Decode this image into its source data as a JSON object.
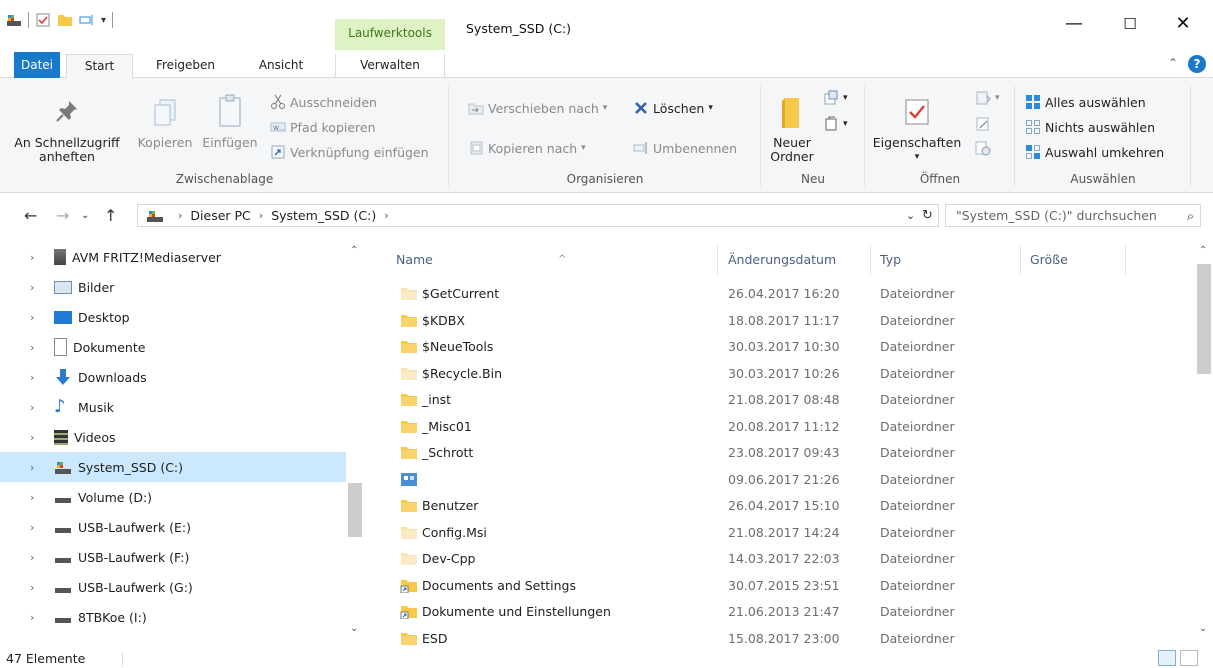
{
  "titlebar": {
    "context_tab": "Laufwerktools",
    "title": "System_SSD (C:)",
    "minimize": "—",
    "maximize": "☐",
    "close": "✕"
  },
  "tabs": {
    "file": "Datei",
    "start": "Start",
    "share": "Freigeben",
    "view": "Ansicht",
    "manage": "Verwalten"
  },
  "ribbon": {
    "clipboard": {
      "label": "Zwischenablage",
      "pin_line1": "An Schnellzugriff",
      "pin_line2": "anheften",
      "copy": "Kopieren",
      "paste": "Einfügen",
      "cut": "Ausschneiden",
      "copy_path": "Pfad kopieren",
      "paste_shortcut": "Verknüpfung einfügen"
    },
    "organize": {
      "label": "Organisieren",
      "move_to": "Verschieben nach",
      "copy_to": "Kopieren nach",
      "delete": "Löschen",
      "rename": "Umbenennen"
    },
    "new": {
      "label": "Neu",
      "new_folder_line1": "Neuer",
      "new_folder_line2": "Ordner"
    },
    "open": {
      "label": "Öffnen",
      "properties": "Eigenschaften"
    },
    "select": {
      "label": "Auswählen",
      "select_all": "Alles auswählen",
      "select_none": "Nichts auswählen",
      "invert": "Auswahl umkehren"
    }
  },
  "address": {
    "crumbs": [
      "Dieser PC",
      "System_SSD (C:)"
    ],
    "search_placeholder": "\"System_SSD (C:)\" durchsuchen"
  },
  "nav": {
    "items": [
      {
        "label": "AVM FRITZ!Mediaserver",
        "icon": "media-server-icon"
      },
      {
        "label": "Bilder",
        "icon": "pictures-icon"
      },
      {
        "label": "Desktop",
        "icon": "desktop-icon"
      },
      {
        "label": "Dokumente",
        "icon": "documents-icon"
      },
      {
        "label": "Downloads",
        "icon": "downloads-icon"
      },
      {
        "label": "Musik",
        "icon": "music-icon"
      },
      {
        "label": "Videos",
        "icon": "videos-icon"
      },
      {
        "label": "System_SSD (C:)",
        "icon": "system-drive-icon"
      },
      {
        "label": "Volume (D:)",
        "icon": "drive-icon"
      },
      {
        "label": "USB-Laufwerk (E:)",
        "icon": "drive-icon"
      },
      {
        "label": "USB-Laufwerk (F:)",
        "icon": "drive-icon"
      },
      {
        "label": "USB-Laufwerk (G:)",
        "icon": "drive-icon"
      },
      {
        "label": "8TBKoe (I:)",
        "icon": "drive-icon"
      }
    ],
    "selected_index": 7
  },
  "list": {
    "columns": {
      "name": "Name",
      "date": "Änderungsdatum",
      "type": "Typ",
      "size": "Größe"
    },
    "rows": [
      {
        "name": "$GetCurrent",
        "date": "26.04.2017 16:20",
        "type": "Dateiordner",
        "icon": "folder-light-icon"
      },
      {
        "name": "$KDBX",
        "date": "18.08.2017 11:17",
        "type": "Dateiordner",
        "icon": "folder-icon"
      },
      {
        "name": "$NeueTools",
        "date": "30.03.2017 10:30",
        "type": "Dateiordner",
        "icon": "folder-icon"
      },
      {
        "name": "$Recycle.Bin",
        "date": "30.03.2017 10:26",
        "type": "Dateiordner",
        "icon": "folder-light-icon"
      },
      {
        "name": "_inst",
        "date": "21.08.2017 08:48",
        "type": "Dateiordner",
        "icon": "folder-icon"
      },
      {
        "name": "_Misc01",
        "date": "20.08.2017 11:12",
        "type": "Dateiordner",
        "icon": "folder-icon"
      },
      {
        "name": "_Schrott",
        "date": "23.08.2017 09:43",
        "type": "Dateiordner",
        "icon": "folder-icon"
      },
      {
        "name": "",
        "date": "09.06.2017 21:26",
        "type": "Dateiordner",
        "icon": "special-folder-icon"
      },
      {
        "name": "Benutzer",
        "date": "26.04.2017 15:10",
        "type": "Dateiordner",
        "icon": "folder-icon"
      },
      {
        "name": "Config.Msi",
        "date": "21.08.2017 14:24",
        "type": "Dateiordner",
        "icon": "folder-light-icon"
      },
      {
        "name": "Dev-Cpp",
        "date": "14.03.2017 22:03",
        "type": "Dateiordner",
        "icon": "folder-light-icon"
      },
      {
        "name": "Documents and Settings",
        "date": "30.07.2015 23:51",
        "type": "Dateiordner",
        "icon": "shortcut-folder-icon"
      },
      {
        "name": "Dokumente und Einstellungen",
        "date": "21.06.2013 21:47",
        "type": "Dateiordner",
        "icon": "shortcut-folder-icon"
      },
      {
        "name": "ESD",
        "date": "15.08.2017 23:00",
        "type": "Dateiordner",
        "icon": "folder-icon"
      }
    ]
  },
  "status": {
    "count": "47 Elemente"
  },
  "colors": {
    "accent": "#1979ca",
    "selection": "#cce8ff",
    "context_tab": "#dff2c4",
    "folder": "#f7c948"
  }
}
